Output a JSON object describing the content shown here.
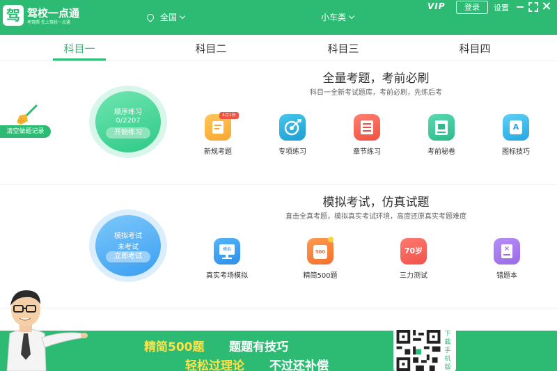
{
  "app": {
    "logo_char": "驾",
    "title": "驾校一点通",
    "slogan": "考驾照  先上驾校一点通"
  },
  "header": {
    "region": "全国",
    "car_type": "小车类",
    "vip": "VIP",
    "login": "登录",
    "settings": "设置"
  },
  "tabs": [
    {
      "label": "科目一",
      "active": true
    },
    {
      "label": "科目二",
      "active": false
    },
    {
      "label": "科目三",
      "active": false
    },
    {
      "label": "科目四",
      "active": false
    }
  ],
  "practice": {
    "clear_record": "清空做题记录",
    "title": "全量考题，考前必刷",
    "subtitle": "科目一全新考试题库，考前必刷，先练后考",
    "circle": {
      "label": "顺序练习",
      "progress": "0/2207",
      "button": "开始练习"
    },
    "features": [
      {
        "label": "新规考题",
        "icon": "new-rules-icon",
        "badge": "4月1日",
        "color": "#f7a733"
      },
      {
        "label": "专项练习",
        "icon": "target-icon",
        "color": "#21a8d8"
      },
      {
        "label": "章节练习",
        "icon": "list-icon",
        "color": "#f2604e"
      },
      {
        "label": "考前秘卷",
        "icon": "exam-paper-icon",
        "color": "#33c69a"
      },
      {
        "label": "图标技巧",
        "icon": "sign-icon",
        "color": "#2fb6e8"
      }
    ]
  },
  "mock": {
    "title": "模拟考试，仿真试题",
    "subtitle": "直击全真考题，模拟真实考试环境，高度还原真实考题难度",
    "circle": {
      "label": "模拟考试",
      "status": "未考试",
      "button": "立即考试"
    },
    "features": [
      {
        "label": "真实考场模拟",
        "icon": "monitor-icon",
        "tag": "模拟",
        "color": "#2f8fe8"
      },
      {
        "label": "精简500题",
        "icon": "500-icon",
        "tag": "500",
        "color": "#f3702e"
      },
      {
        "label": "三力测试",
        "icon": "three-power-icon",
        "tag": "70岁",
        "color": "#f0524a"
      },
      {
        "label": "错题本",
        "icon": "wrong-book-icon",
        "color": "#9a6be8"
      }
    ]
  },
  "banner": {
    "line1_a": "精简500题",
    "line1_b": "题题有技巧",
    "line2_a": "轻松过理论",
    "line2_b": "不过还补偿",
    "qr_label": "下载手机版"
  },
  "colors": {
    "brand": "#2dbb73",
    "banner_yellow": "#ffe14a"
  }
}
